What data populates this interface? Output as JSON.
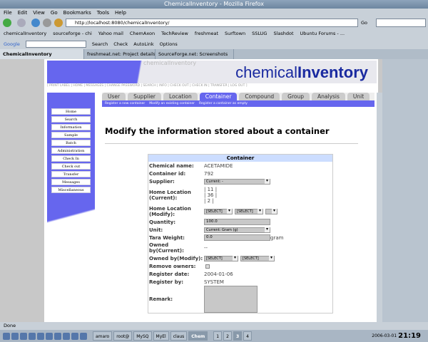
{
  "window": {
    "title": "ChemicalInventory - Mozilla Firefox"
  },
  "menu": [
    "File",
    "Edit",
    "View",
    "Go",
    "Bookmarks",
    "Tools",
    "Help"
  ],
  "url": "http://localhost:8080/chemicalInventory/",
  "go_label": "Go",
  "bookmarks": [
    "chemicalInventory",
    "sourceforge - chi",
    "Yahoo mail",
    "ChemAxon",
    "TechReview",
    "freshmeat",
    "Surftown",
    "SSLUG",
    "Slashdot",
    "Ubuntu Forums - ..."
  ],
  "google_bar": {
    "logo": "Google",
    "search": "Search",
    "check": "Check",
    "autolink": "AutoLink",
    "options": "Options"
  },
  "tabs": [
    "ChemicalInventory",
    "freshmeat.net: Project details for...",
    "SourceForge.net: Screenshots"
  ],
  "banner": {
    "logo_a": "chemical",
    "logo_b": "Inventory",
    "ghost": "chemicalInventory"
  },
  "toplinks": "[ PRINT LABEL | HOME | MESSAGES | CHANGE PASSWORD | SEARCH | INFO | CHECK OUT | CHECK IN | TRANSFER | LOG OUT ]",
  "sidebar": [
    "Home",
    "Search",
    "Information",
    "Sample",
    "Batch",
    "Administration",
    "Check In",
    "Check out",
    "Transfer",
    "Messages",
    "Miscellaneous"
  ],
  "app_tabs": [
    "User",
    "Supplier",
    "Location",
    "Container",
    "Compound",
    "Group",
    "Analysis",
    "Unit"
  ],
  "subnav": [
    "Register a new container",
    "Modify an existing container",
    "Register a container as empty"
  ],
  "page_title": "Modify the information stored about a container",
  "form": {
    "header": "Container",
    "chemical_name": {
      "label": "Chemical name:",
      "value": "ACETAMIDE"
    },
    "container_id": {
      "label": "Container id:",
      "value": "792"
    },
    "supplier": {
      "label": "Supplier:",
      "value": "Current: -"
    },
    "home_current": {
      "label": "Home Location (Current):",
      "lines": [
        "| 11 |",
        "| 36 |",
        "| 2 |"
      ]
    },
    "home_modify": {
      "label": "Home Location (Modify):",
      "sel1": "[SELECT]",
      "sel2": "[SELECT]"
    },
    "quantity": {
      "label": "Quantity:",
      "value": "100.0"
    },
    "unit": {
      "label": "Unit:",
      "value": "Current: Gram (g)"
    },
    "tara": {
      "label": "Tara Weight:",
      "value": "0.0",
      "suffix": "gram"
    },
    "owned_current": {
      "label": "Owned by(Current):",
      "value": "--"
    },
    "owned_modify": {
      "label": "Owned by(Modify):",
      "sel1": "[SELECT]",
      "sel2": "[SELECT]"
    },
    "remove_owners": {
      "label": "Remove owners:"
    },
    "register_date": {
      "label": "Register date:",
      "value": "2004-01-06"
    },
    "register_by": {
      "label": "Register by:",
      "value": "SYSTEM"
    },
    "remark": {
      "label": "Remark:"
    }
  },
  "status": "Done",
  "taskbar": {
    "tasks": [
      "amaro",
      "root@",
      "MySQ",
      "MyEl",
      "claus",
      "Chem"
    ],
    "desktops": [
      "1",
      "2",
      "3",
      "4"
    ],
    "date": "2006-03-01",
    "time": "21:19"
  }
}
